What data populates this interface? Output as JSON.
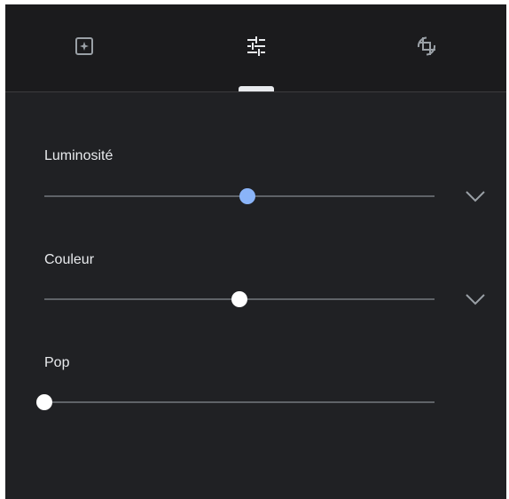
{
  "tabs": [
    {
      "id": "auto-enhance",
      "icon": "sparkle-square-icon",
      "active": false
    },
    {
      "id": "adjust",
      "icon": "sliders-icon",
      "active": true
    },
    {
      "id": "crop-rotate",
      "icon": "crop-rotate-icon",
      "active": false
    }
  ],
  "adjustments": [
    {
      "label": "Luminosité",
      "value": 0.52,
      "thumb_color": "#8ab4f8",
      "expandable": true,
      "expand_icon": "chevron-down-icon"
    },
    {
      "label": "Couleur",
      "value": 0.5,
      "thumb_color": "#ffffff",
      "expandable": true,
      "expand_icon": "chevron-down-icon"
    },
    {
      "label": "Pop",
      "value": 0.0,
      "thumb_color": "#ffffff",
      "expandable": false
    }
  ],
  "colors": {
    "background": "#202124",
    "tabbar": "#1b1b1d",
    "text": "#e8eaed",
    "icon": "#9aa0a6",
    "active_icon": "#e8eaed",
    "track": "#5f6368",
    "accent": "#8ab4f8"
  }
}
